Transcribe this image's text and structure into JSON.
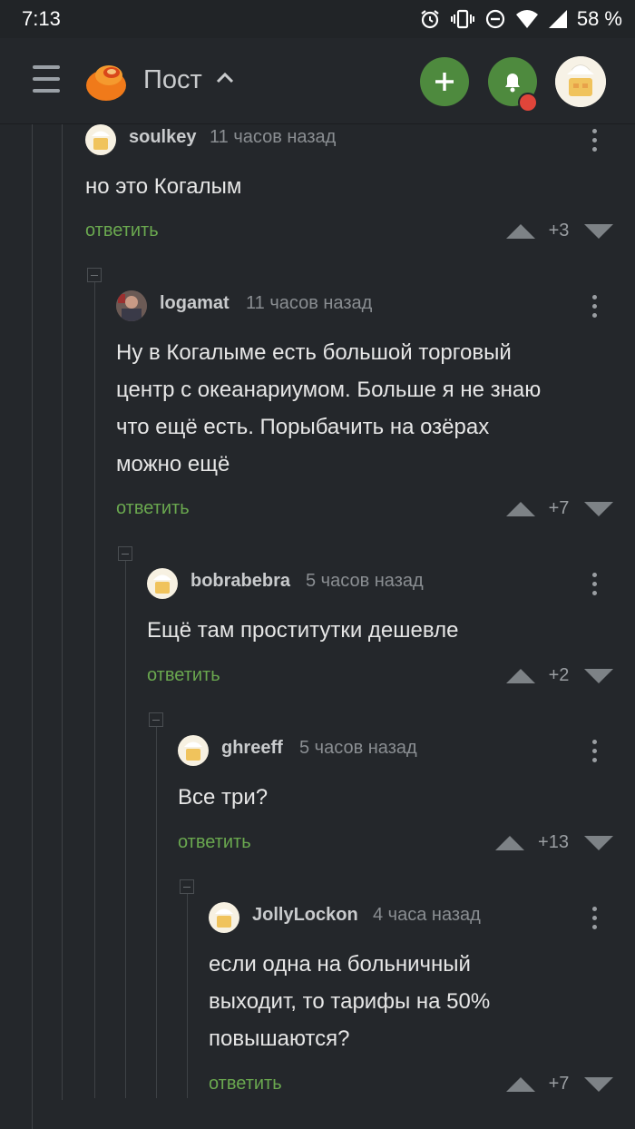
{
  "status_bar": {
    "time": "7:13",
    "battery": "58 %",
    "icons": [
      "alarm-icon",
      "vibrate-icon",
      "dnd-icon",
      "wifi-icon",
      "signal-icon"
    ]
  },
  "app_bar": {
    "title": "Пост",
    "icons": [
      "menu-icon",
      "pikabu-logo",
      "chevron-up-icon",
      "add-icon",
      "bell-icon",
      "avatar"
    ],
    "accent": "#4e8a3e",
    "notification_color": "#e0453a"
  },
  "comments": [
    {
      "user": "soulkey",
      "time": "11 часов назад",
      "text": "но это Когалым",
      "reply": "ответить",
      "rating": "+3"
    },
    {
      "user": "logamat",
      "time": "11 часов назад",
      "text": "Ну в Когалыме есть большой торговый\nцентр с океанариумом. Больше я не знаю\nчто ещё есть. Порыбачить на озёрах\nможно ещё",
      "reply": "ответить",
      "rating": "+7"
    },
    {
      "user": "bobrabebra",
      "time": "5 часов назад",
      "text": "Ещё там проститутки дешевле",
      "reply": "ответить",
      "rating": "+2"
    },
    {
      "user": "ghreeff",
      "time": "5 часов назад",
      "text": "Все три?",
      "reply": "ответить",
      "rating": "+13"
    },
    {
      "user": "JollyLockon",
      "time": "4 часа назад",
      "text": "если одна на больничный\nвыходит, то тарифы на 50%\nповышаются?",
      "reply": "ответить",
      "rating": "+7"
    }
  ],
  "colors": {
    "background": "#24272b",
    "reply_link": "#6aa84f",
    "muted": "#8a8e92"
  }
}
